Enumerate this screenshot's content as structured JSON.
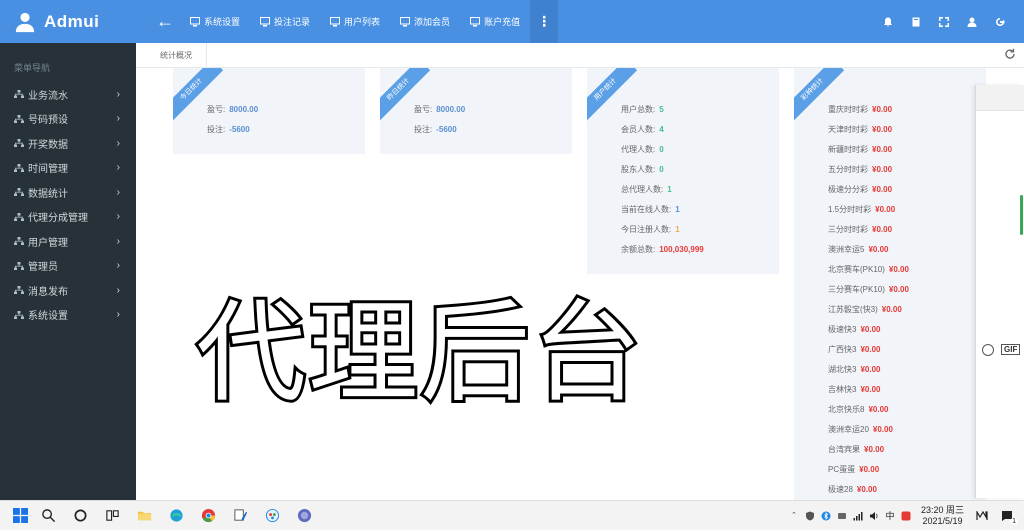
{
  "brand": {
    "name": "Admui"
  },
  "nav": [
    {
      "label": "系统设置",
      "icon": "monitor-icon"
    },
    {
      "label": "投注记录",
      "icon": "monitor-icon"
    },
    {
      "label": "用户列表",
      "icon": "monitor-icon"
    },
    {
      "label": "添加会员",
      "icon": "monitor-icon"
    },
    {
      "label": "账户充值",
      "icon": "monitor-icon"
    }
  ],
  "sidebar": {
    "title": "菜单导航",
    "items": [
      {
        "label": "业务流水"
      },
      {
        "label": "号码预设"
      },
      {
        "label": "开奖数据"
      },
      {
        "label": "时间管理"
      },
      {
        "label": "数据统计"
      },
      {
        "label": "代理分成管理"
      },
      {
        "label": "用户管理"
      },
      {
        "label": "管理员"
      },
      {
        "label": "消息发布"
      },
      {
        "label": "系统设置"
      }
    ]
  },
  "tabs": [
    {
      "label": "统计概况"
    }
  ],
  "cards": {
    "today": {
      "ribbon": "今日统计",
      "rows": [
        {
          "label": "盈亏:",
          "value": "8000.00"
        },
        {
          "label": "投注:",
          "value": "-5600"
        }
      ]
    },
    "yesterday": {
      "ribbon": "昨日统计",
      "rows": [
        {
          "label": "盈亏:",
          "value": "8000.00"
        },
        {
          "label": "投注:",
          "value": "-5600"
        }
      ]
    },
    "users": {
      "ribbon": "用户统计",
      "rows": [
        {
          "label": "用户总数:",
          "value": "5",
          "color": "green"
        },
        {
          "label": "会员人数:",
          "value": "4",
          "color": "green"
        },
        {
          "label": "代理人数:",
          "value": "0",
          "color": "green"
        },
        {
          "label": "股东人数:",
          "value": "0",
          "color": "green"
        },
        {
          "label": "总代理人数:",
          "value": "1",
          "color": "green"
        },
        {
          "label": "当前在线人数:",
          "value": "1",
          "color": "blue"
        },
        {
          "label": "今日注册人数:",
          "value": "1",
          "color": "orange"
        },
        {
          "label": "余额总数:",
          "value": "100,030,999",
          "color": "red"
        }
      ]
    },
    "lottery": {
      "ribbon": "彩种统计",
      "rows": [
        {
          "label": "重庆时时彩",
          "value": "¥0.00"
        },
        {
          "label": "天津时时彩",
          "value": "¥0.00"
        },
        {
          "label": "新疆时时彩",
          "value": "¥0.00"
        },
        {
          "label": "五分时时彩",
          "value": "¥0.00"
        },
        {
          "label": "极速分分彩",
          "value": "¥0.00"
        },
        {
          "label": "1.5分时时彩",
          "value": "¥0.00"
        },
        {
          "label": "三分时时彩",
          "value": "¥0.00"
        },
        {
          "label": "澳洲幸运5",
          "value": "¥0.00"
        },
        {
          "label": "北京赛车(PK10)",
          "value": "¥0.00"
        },
        {
          "label": "三分赛车(PK10)",
          "value": "¥0.00"
        },
        {
          "label": "江苏骰宝(快3)",
          "value": "¥0.00"
        },
        {
          "label": "极速快3",
          "value": "¥0.00"
        },
        {
          "label": "广西快3",
          "value": "¥0.00"
        },
        {
          "label": "湖北快3",
          "value": "¥0.00"
        },
        {
          "label": "吉林快3",
          "value": "¥0.00"
        },
        {
          "label": "北京快乐8",
          "value": "¥0.00"
        },
        {
          "label": "澳洲幸运20",
          "value": "¥0.00"
        },
        {
          "label": "台湾宾果",
          "value": "¥0.00"
        },
        {
          "label": "PC蛋蛋",
          "value": "¥0.00"
        },
        {
          "label": "极速28",
          "value": "¥0.00"
        }
      ]
    }
  },
  "overlay": {
    "text": "代理后台"
  },
  "side_panel": {
    "gif": "GIF"
  },
  "taskbar": {
    "ime": "中",
    "time": "23:20 周三",
    "date": "2021/5/19",
    "notify": "1"
  }
}
